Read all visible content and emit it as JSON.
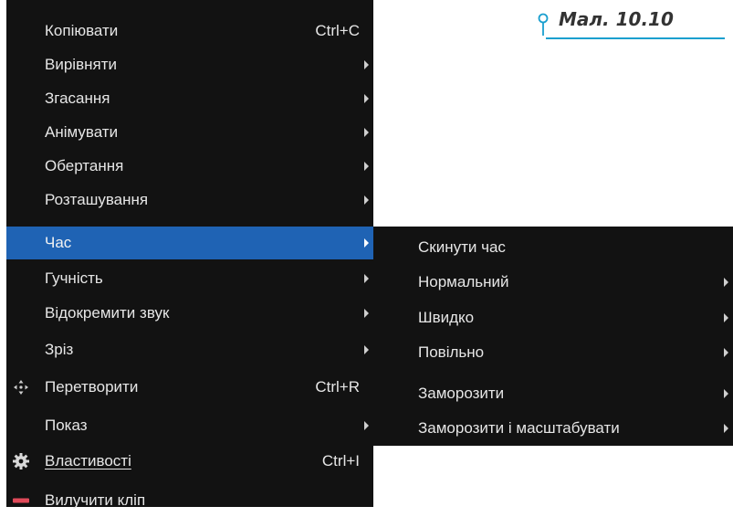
{
  "caption": {
    "text": "Мал. 10.10",
    "color": "#1a9fcf",
    "icon": "location-pin-icon"
  },
  "colors": {
    "menu_bg": "#121212",
    "menu_text": "#e6e6e6",
    "selected_bg": "#1f63b4"
  },
  "main_menu": {
    "items": [
      {
        "label": "Копіювати",
        "shortcut": "Ctrl+C"
      },
      {
        "label": "Вирівняти"
      },
      {
        "label": "Згасання"
      },
      {
        "label": "Анімувати"
      },
      {
        "label": "Обертання"
      },
      {
        "label": "Розташування"
      },
      {
        "label": "Час",
        "selected": true
      },
      {
        "label": "Гучність"
      },
      {
        "label": "Відокремити звук"
      },
      {
        "label": "Зріз"
      },
      {
        "label": "Перетворити",
        "shortcut": "Ctrl+R",
        "icon": "transform-move-icon"
      },
      {
        "label": "Показ"
      },
      {
        "label": "Властивості",
        "shortcut": "Ctrl+I",
        "icon": "gear-icon"
      },
      {
        "label": "Вилучити кліп",
        "icon": "remove-clip-icon"
      }
    ]
  },
  "submenu": {
    "items": [
      {
        "label": "Скинути час"
      },
      {
        "label": "Нормальний"
      },
      {
        "label": "Швидко"
      },
      {
        "label": "Повільно"
      },
      {
        "label": "Заморозити"
      },
      {
        "label": "Заморозити і масштабувати"
      }
    ]
  }
}
